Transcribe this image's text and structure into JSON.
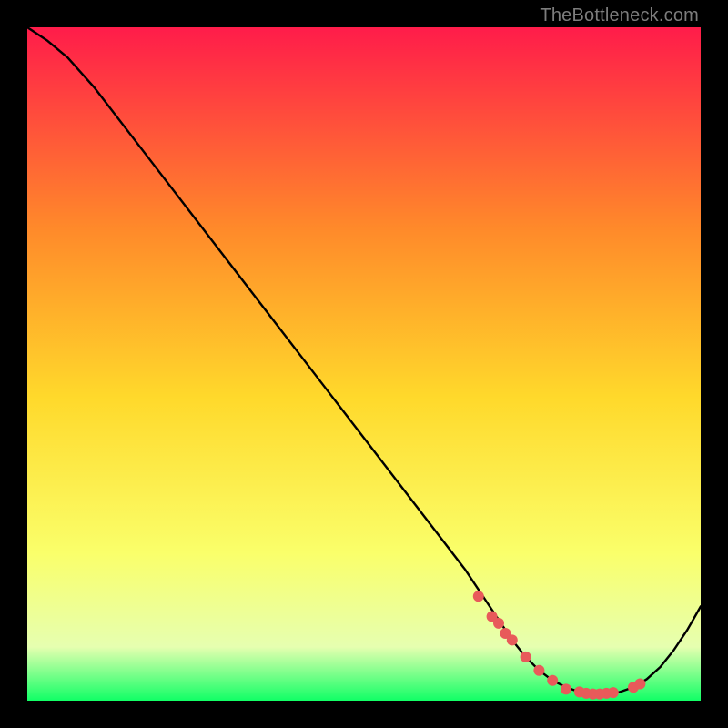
{
  "watermark": "TheBottleneck.com",
  "chart_data": {
    "type": "line",
    "title": "",
    "xlabel": "",
    "ylabel": "",
    "xlim": [
      0,
      100
    ],
    "ylim": [
      0,
      100
    ],
    "x": [
      0,
      3,
      6,
      10,
      15,
      20,
      25,
      30,
      35,
      40,
      45,
      50,
      55,
      60,
      65,
      68,
      70,
      72,
      74,
      76,
      78,
      80,
      82,
      84,
      86,
      88,
      90,
      92,
      94,
      96,
      98,
      100
    ],
    "y": [
      100,
      98,
      95.5,
      91,
      84.5,
      78,
      71.5,
      65,
      58.5,
      52,
      45.5,
      39,
      32.5,
      26,
      19.5,
      15,
      12,
      9,
      6.5,
      4.5,
      3,
      2,
      1.3,
      1,
      1,
      1.3,
      2,
      3.2,
      5,
      7.5,
      10.5,
      14
    ],
    "marker_points": {
      "x": [
        67,
        69,
        70,
        71,
        72,
        74,
        76,
        78,
        80,
        82,
        83,
        84,
        85,
        86,
        87,
        90,
        91
      ],
      "y": [
        15.5,
        12.5,
        11.5,
        10,
        9,
        6.5,
        4.5,
        3,
        1.7,
        1.3,
        1.1,
        1,
        1,
        1.1,
        1.2,
        2,
        2.5
      ]
    },
    "gradient": {
      "top": "#ff1c4a",
      "upper_mid": "#ff8a2a",
      "mid": "#ffd92b",
      "lower_mid": "#faff6a",
      "low": "#e6ffb0",
      "bottom": "#11ff66"
    },
    "line_color": "#000000",
    "marker_color": "#e85a5a"
  }
}
